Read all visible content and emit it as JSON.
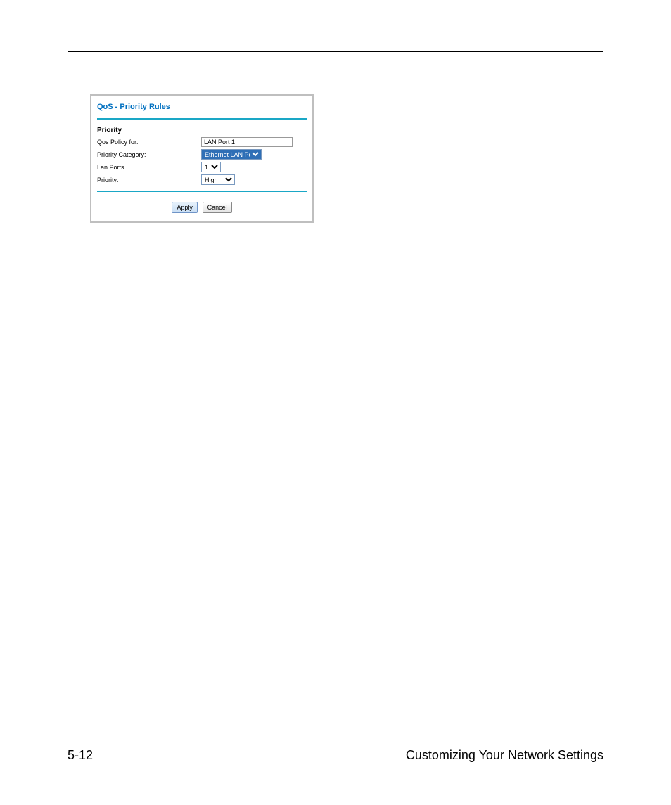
{
  "panel": {
    "title": "QoS - Priority Rules",
    "section_heading": "Priority",
    "rows": {
      "policy_for": {
        "label": "Qos Policy for:",
        "value": "LAN Port 1"
      },
      "priority_category": {
        "label": "Priority Category:",
        "value": "Ethernet LAN Port"
      },
      "lan_ports": {
        "label": "Lan Ports",
        "value": "1"
      },
      "priority": {
        "label": "Priority:",
        "value": "High"
      }
    },
    "buttons": {
      "apply": "Apply",
      "cancel": "Cancel"
    }
  },
  "footer": {
    "page_number": "5-12",
    "chapter_title": "Customizing Your Network Settings"
  }
}
